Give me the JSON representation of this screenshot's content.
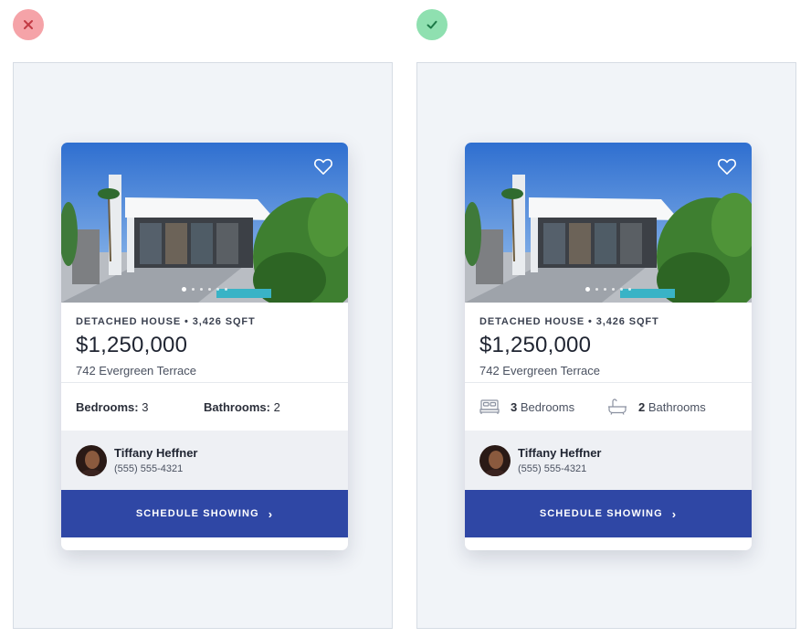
{
  "comparison": {
    "bad_badge": "x-icon",
    "good_badge": "check-icon",
    "colors": {
      "bad": "#f5a3a8",
      "good": "#8fe0b0",
      "accent": "#2f47a5"
    }
  },
  "listing": {
    "meta": "DETACHED HOUSE • 3,426 SQFT",
    "price": "$1,250,000",
    "address": "742 Evergreen Terrace",
    "photo_pager": {
      "count": 6,
      "active": 1
    }
  },
  "left_card": {
    "bedrooms_label": "Bedrooms:",
    "bedrooms_value": "3",
    "bathrooms_label": "Bathrooms:",
    "bathrooms_value": "2"
  },
  "right_card": {
    "bedrooms_value": "3",
    "bedrooms_label": "Bedrooms",
    "bathrooms_value": "2",
    "bathrooms_label": "Bathrooms"
  },
  "agent": {
    "name": "Tiffany Heffner",
    "phone": "(555) 555-4321"
  },
  "cta": {
    "label": "SCHEDULE SHOWING",
    "chevron": "›"
  }
}
